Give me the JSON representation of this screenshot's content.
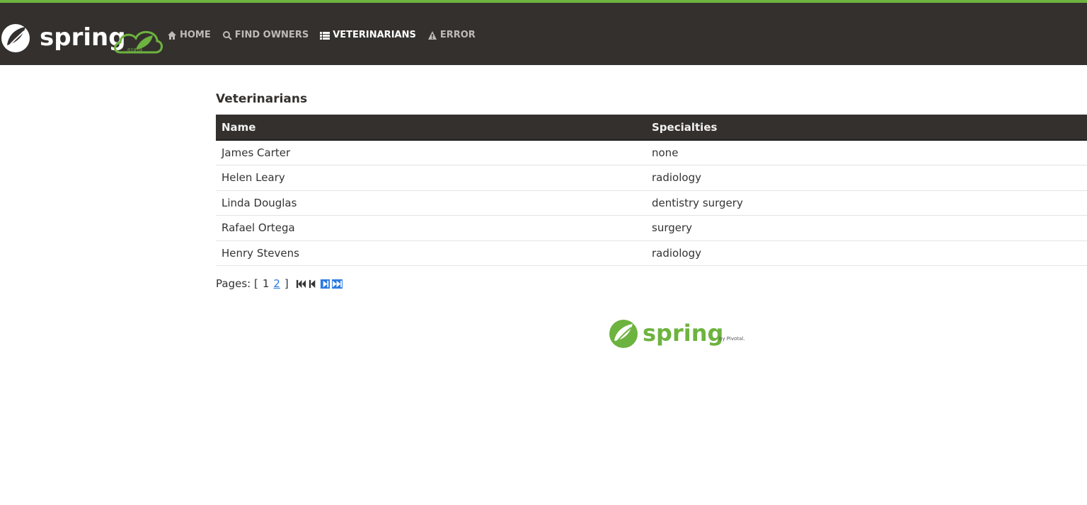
{
  "brand": {
    "name": "spring",
    "cloud_text": "01010"
  },
  "nav": {
    "items": [
      {
        "label": "HOME",
        "icon": "home-icon"
      },
      {
        "label": "FIND OWNERS",
        "icon": "search-icon"
      },
      {
        "label": "VETERINARIANS",
        "icon": "list-icon",
        "active": true
      },
      {
        "label": "ERROR",
        "icon": "warning-icon"
      }
    ]
  },
  "page": {
    "title": "Veterinarians"
  },
  "table": {
    "headers": [
      "Name",
      "Specialties"
    ],
    "rows": [
      {
        "name": "James Carter",
        "specialties": "none"
      },
      {
        "name": "Helen Leary",
        "specialties": "radiology"
      },
      {
        "name": "Linda Douglas",
        "specialties": "dentistry surgery"
      },
      {
        "name": "Rafael Ortega",
        "specialties": "surgery"
      },
      {
        "name": "Henry Stevens",
        "specialties": "radiology"
      }
    ]
  },
  "pagination": {
    "prefix": "Pages: [",
    "current": "1",
    "next_link": "2",
    "suffix": "]"
  },
  "footer": {
    "logo_text": "spring",
    "by_text": "by Pivotal."
  },
  "colors": {
    "navbar": "#34302d",
    "accent": "#6db33f",
    "link": "#2a7ae2"
  }
}
